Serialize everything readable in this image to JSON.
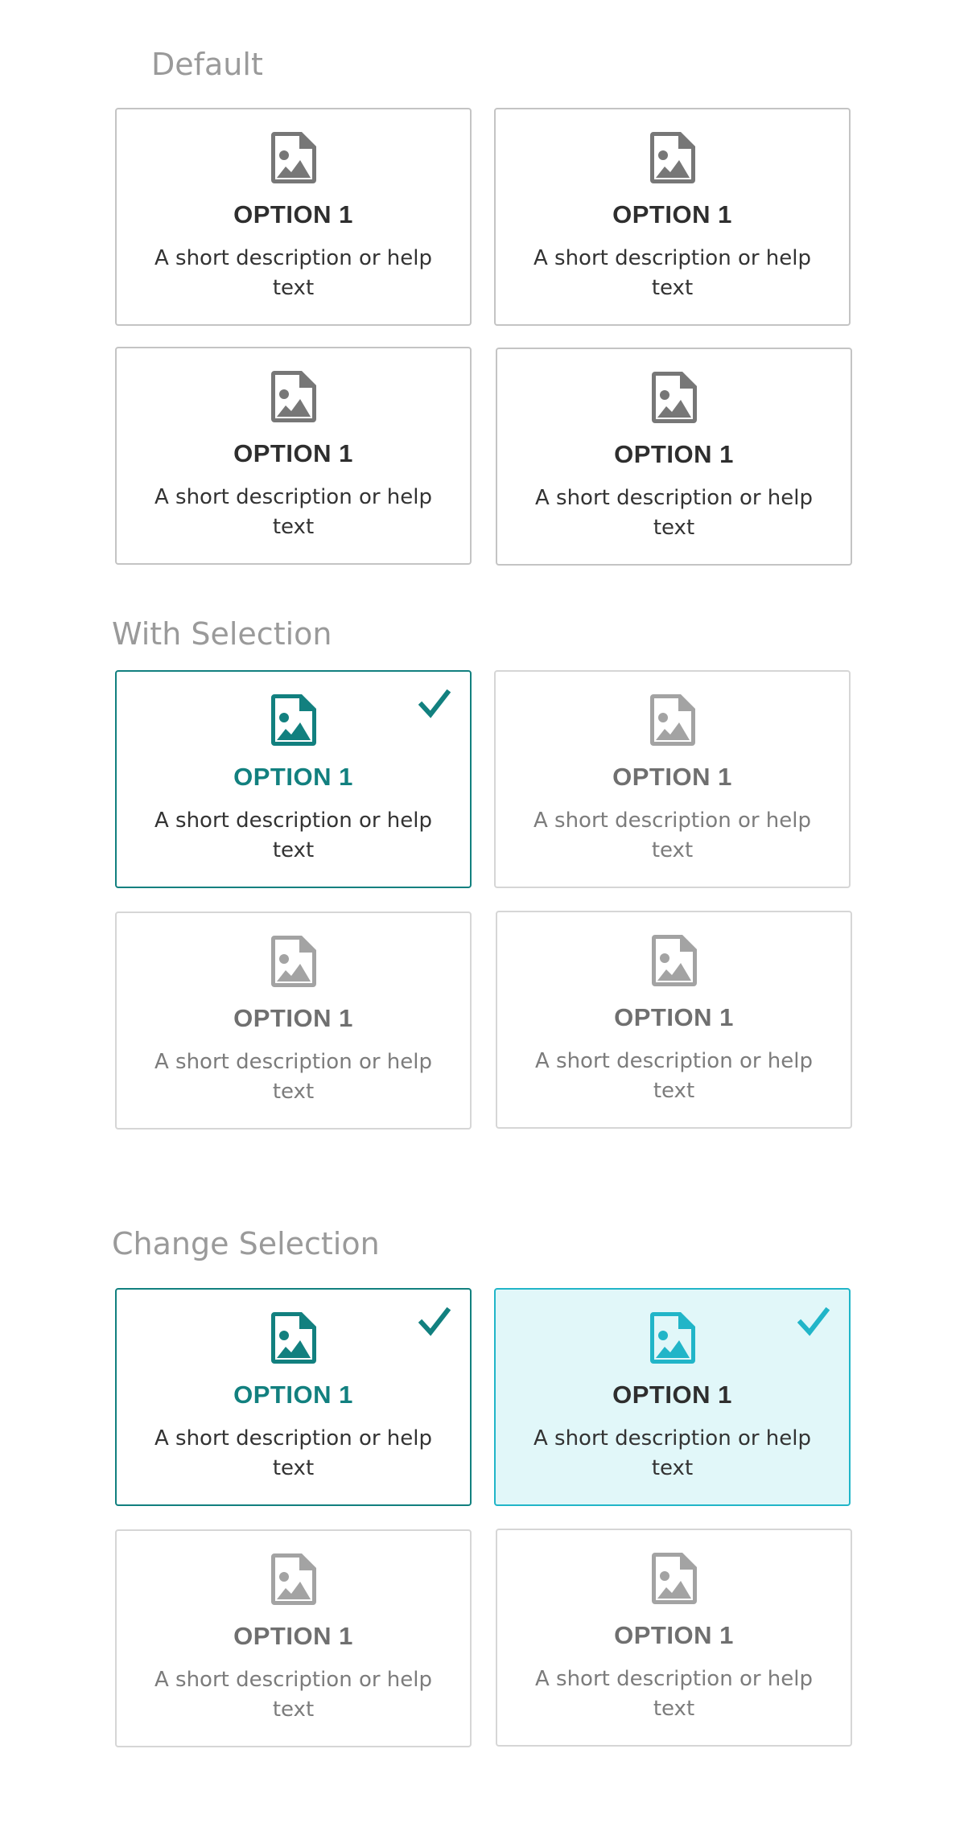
{
  "sections": {
    "default": {
      "title": "Default"
    },
    "with_selection": {
      "title": "With Selection"
    },
    "change_selection": {
      "title": "Change Selection"
    }
  },
  "cards": {
    "default": [
      {
        "title": "OPTION 1",
        "description": "A short description or help text",
        "icon": "image-file-icon",
        "state": "default"
      },
      {
        "title": "OPTION 1",
        "description": "A short description or help text",
        "icon": "image-file-icon",
        "state": "default"
      },
      {
        "title": "OPTION 1",
        "description": "A short description or help text",
        "icon": "image-file-icon",
        "state": "default"
      },
      {
        "title": "OPTION 1",
        "description": "A short description or help text",
        "icon": "image-file-icon",
        "state": "default"
      }
    ],
    "with_selection": [
      {
        "title": "OPTION 1",
        "description": "A short description or help text",
        "icon": "image-file-icon",
        "state": "selected",
        "checked": true
      },
      {
        "title": "OPTION 1",
        "description": "A short description or help text",
        "icon": "image-file-icon",
        "state": "unselected"
      },
      {
        "title": "OPTION 1",
        "description": "A short description or help text",
        "icon": "image-file-icon",
        "state": "unselected"
      },
      {
        "title": "OPTION 1",
        "description": "A short description or help text",
        "icon": "image-file-icon",
        "state": "unselected"
      }
    ],
    "change_selection": [
      {
        "title": "OPTION 1",
        "description": "A short description or help text",
        "icon": "image-file-icon",
        "state": "selected",
        "checked": true
      },
      {
        "title": "OPTION 1",
        "description": "A short description or help text",
        "icon": "image-file-icon",
        "state": "hover-selected",
        "checked": true
      },
      {
        "title": "OPTION 1",
        "description": "A short description or help text",
        "icon": "image-file-icon",
        "state": "unselected"
      },
      {
        "title": "OPTION 1",
        "description": "A short description or help text",
        "icon": "image-file-icon",
        "state": "unselected"
      }
    ]
  },
  "colors": {
    "section_title": "#9a9a9a",
    "default_border": "#c4c4c4",
    "dim_border": "#d6d6d6",
    "selected_accent": "#12807f",
    "hover_accent": "#21b5c8",
    "hover_background": "#e1f7f9",
    "title_text": "#2e2e2e"
  }
}
